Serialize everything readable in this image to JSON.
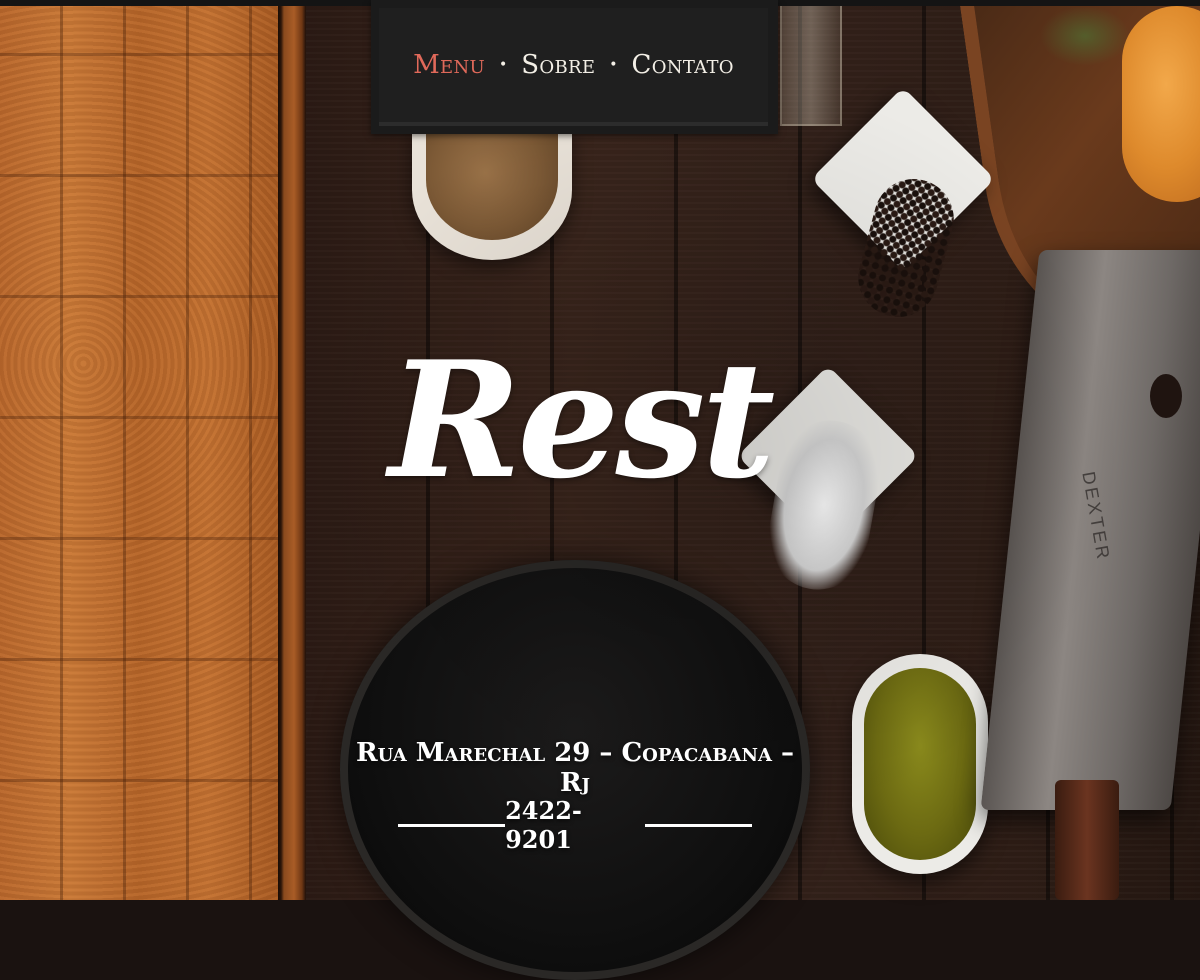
{
  "nav": {
    "items": [
      {
        "label": "Menu",
        "active": true
      },
      {
        "label": "Sobre",
        "active": false
      },
      {
        "label": "Contato",
        "active": false
      }
    ],
    "separator": "•"
  },
  "hero": {
    "logo_text": "Rest",
    "address": "Rua Marechal 29 – Copacabana – Rj",
    "phone": "2422-9201",
    "knife_brand": "DEXTER"
  },
  "colors": {
    "accent": "#e0695a",
    "nav_bg": "#1f1f1f",
    "text": "#ffffff"
  }
}
